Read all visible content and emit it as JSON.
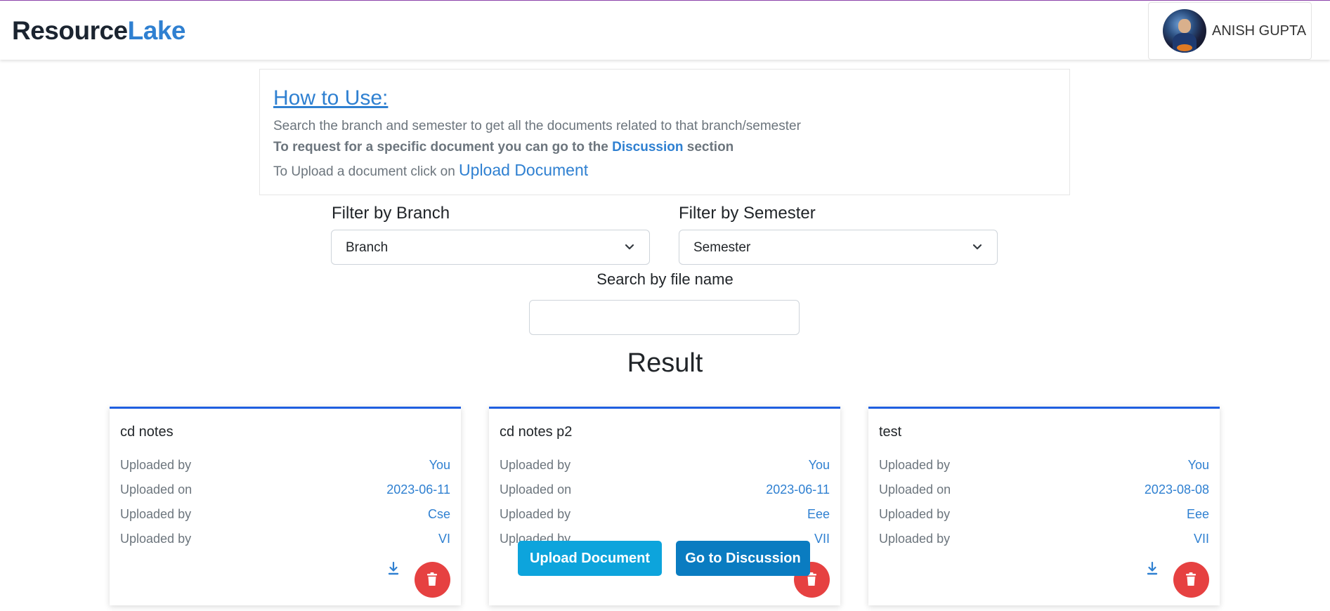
{
  "navbar": {
    "brand_part1": "Resource",
    "brand_part2": "Lake",
    "user_name": "ANISH GUPTA"
  },
  "howto": {
    "title": "How to Use:",
    "line1": "Search the branch and semester to get all the documents related to that branch/semester",
    "line2_prefix": "To request for a specific document you can go to the ",
    "line2_link": "Discussion",
    "line2_suffix": " section",
    "line3_prefix": "To Upload a document click on ",
    "line3_link": "Upload Document"
  },
  "filters": {
    "branch_label": "Filter by Branch",
    "branch_value": "Branch",
    "semester_label": "Filter by Semester",
    "semester_value": "Semester",
    "search_label": "Search by file name",
    "search_value": ""
  },
  "result_title": "Result",
  "cards": [
    {
      "title": "cd notes",
      "rows": [
        {
          "label": "Uploaded by",
          "value": "You"
        },
        {
          "label": "Uploaded on",
          "value": "2023-06-11"
        },
        {
          "label": "Uploaded by",
          "value": "Cse"
        },
        {
          "label": "Uploaded by",
          "value": "VI"
        }
      ]
    },
    {
      "title": "cd notes p2",
      "rows": [
        {
          "label": "Uploaded by",
          "value": "You"
        },
        {
          "label": "Uploaded on",
          "value": "2023-06-11"
        },
        {
          "label": "Uploaded by",
          "value": "Eee"
        },
        {
          "label": "Uploaded by",
          "value": "VII"
        }
      ]
    },
    {
      "title": "test",
      "rows": [
        {
          "label": "Uploaded by",
          "value": "You"
        },
        {
          "label": "Uploaded on",
          "value": "2023-08-08"
        },
        {
          "label": "Uploaded by",
          "value": "Eee"
        },
        {
          "label": "Uploaded by",
          "value": "VII"
        }
      ]
    }
  ],
  "floating": {
    "upload_label": "Upload Document",
    "discussion_label": "Go to Discussion"
  },
  "colors": {
    "brand_accent": "#2f80d1",
    "card_top_border": "#1f5fe0",
    "delete_button": "#e64141",
    "upload_button": "#0da4dc",
    "discussion_button": "#0a7cc1"
  }
}
